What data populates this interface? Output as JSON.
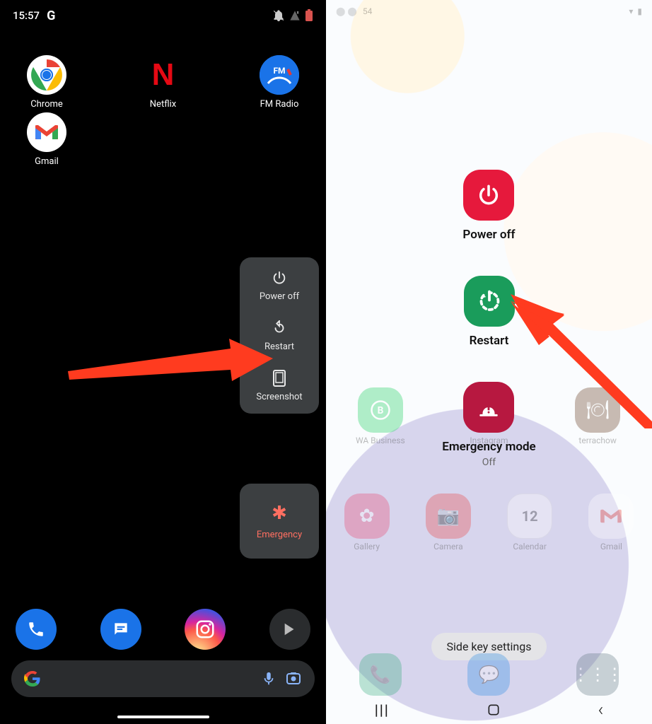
{
  "left": {
    "status": {
      "time": "15:57",
      "google_indicator": "G"
    },
    "apps_row1": [
      {
        "name": "chrome",
        "label": "Chrome"
      },
      {
        "name": "netflix",
        "label": "Netflix"
      },
      {
        "name": "fmradio",
        "label": "FM Radio",
        "badge": "FM"
      }
    ],
    "apps_row2": [
      {
        "name": "gmail",
        "label": "Gmail"
      }
    ],
    "power_menu": {
      "power_off": "Power off",
      "restart": "Restart",
      "screenshot": "Screenshot",
      "emergency": "Emergency"
    },
    "dock": [
      "phone",
      "messages",
      "instagram",
      "play"
    ]
  },
  "right": {
    "status_time": "54",
    "power_menu": {
      "power_off": "Power off",
      "restart": "Restart",
      "emergency_mode": "Emergency mode",
      "emergency_mode_state": "Off"
    },
    "bg_apps_row1": [
      {
        "label": "WA Business"
      },
      {
        "label": "Instagram"
      },
      {
        "label": "terrachow"
      }
    ],
    "bg_apps_row2": [
      {
        "label": "Gallery"
      },
      {
        "label": "Camera"
      },
      {
        "label": "Calendar",
        "badge": "12"
      },
      {
        "label": "Gmail"
      }
    ],
    "side_key": "Side key settings",
    "nav": {
      "recents": "|||",
      "home": "○",
      "back": "‹"
    }
  }
}
